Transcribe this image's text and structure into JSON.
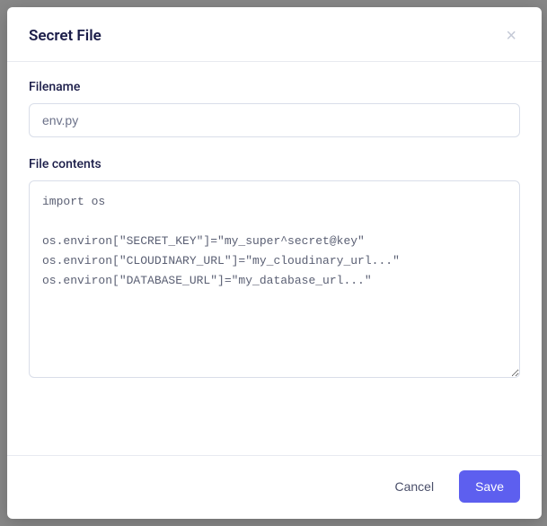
{
  "modal": {
    "title": "Secret File",
    "filename_label": "Filename",
    "filename_value": "env.py",
    "contents_label": "File contents",
    "contents_value": "import os\n\nos.environ[\"SECRET_KEY\"]=\"my_super^secret@key\"\nos.environ[\"CLOUDINARY_URL\"]=\"my_cloudinary_url...\"\nos.environ[\"DATABASE_URL\"]=\"my_database_url...\"",
    "cancel_label": "Cancel",
    "save_label": "Save"
  }
}
